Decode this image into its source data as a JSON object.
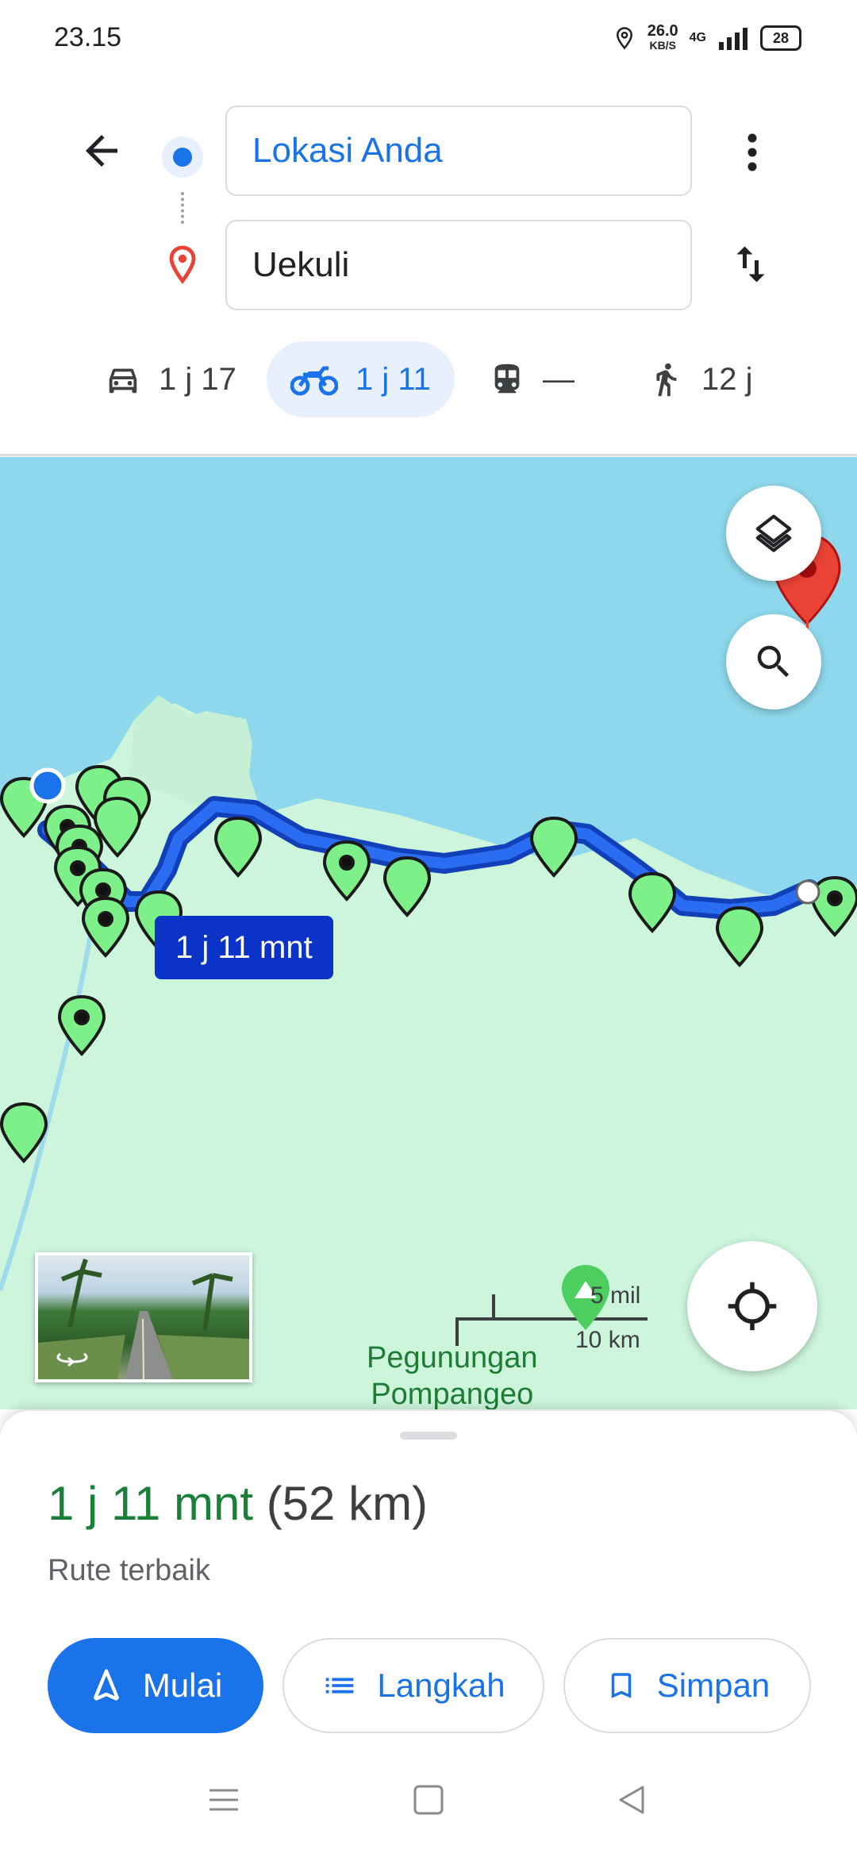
{
  "status": {
    "time": "23.15",
    "speed_value": "26.0",
    "speed_unit": "KB/S",
    "network": "4G",
    "battery": "28"
  },
  "route": {
    "origin": "Lokasi Anda",
    "destination": "Uekuli"
  },
  "modes": [
    {
      "icon": "car-icon",
      "label": "1 j 17"
    },
    {
      "icon": "motorcycle-icon",
      "label": "1 j 11"
    },
    {
      "icon": "train-icon",
      "label": "—"
    },
    {
      "icon": "walk-icon",
      "label": "12 j"
    }
  ],
  "map": {
    "route_label": "1 j 11 mnt",
    "scale_mi": "5 mil",
    "scale_km": "10 km",
    "place_line1": "Pegunungan",
    "place_line2": "Pompangeo"
  },
  "summary": {
    "duration": "1 j 11 mnt",
    "distance": "(52 km)",
    "subtitle": "Rute terbaik"
  },
  "actions": {
    "start": "Mulai",
    "steps": "Langkah",
    "save": "Simpan"
  },
  "colors": {
    "accent": "#1a73e8",
    "route": "#1a5ee8",
    "duration_green": "#188038",
    "marker_green": "#7ef08a",
    "destination_red": "#ea4335"
  }
}
